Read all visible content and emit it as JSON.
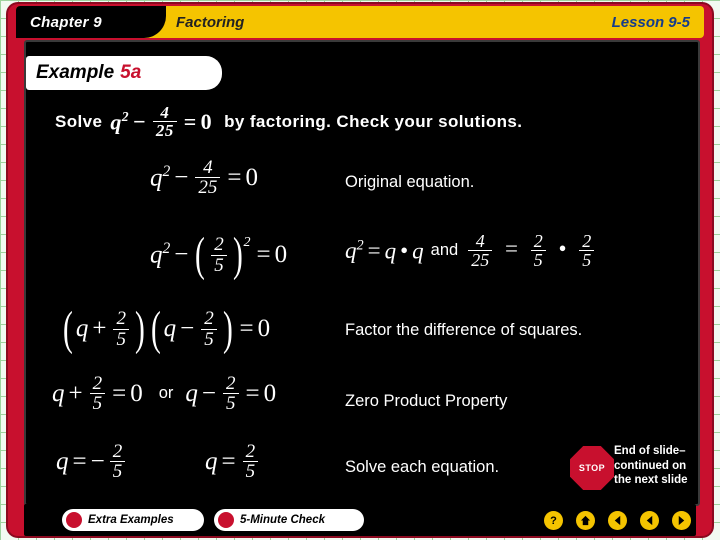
{
  "banner": {
    "chapter": "Chapter 9",
    "topic": "Factoring",
    "lesson": "Lesson 9-5"
  },
  "example_tab": {
    "label": "Example",
    "number": "5a"
  },
  "problem": {
    "solve_word": "Solve",
    "equation": "q² − 4/25 = 0",
    "instruction": "by factoring. Check your solutions."
  },
  "steps": [
    {
      "math": "q² − 4/25 = 0",
      "reason": "Original equation."
    },
    {
      "math": "q² − (2/5)² = 0",
      "reason_math_left": "q² = q • q",
      "reason_and": "and",
      "reason_math_right": "4/25 = 2/5 • 2/5"
    },
    {
      "math": "(q + 2/5)(q − 2/5) = 0",
      "reason": "Factor the difference of squares."
    },
    {
      "math": "q + 2/5 = 0  or  q − 2/5 = 0",
      "reason": "Zero Product Property",
      "or_word": "or"
    },
    {
      "math": "q = −2/5    q = 2/5",
      "reason": "Solve each equation."
    }
  ],
  "end_marker": {
    "stop_label": "STOP",
    "line1": "End of slide–",
    "line2": "continued on",
    "line3": "the next slide"
  },
  "footer": {
    "extra_examples": "Extra Examples",
    "five_minute_check": "5-Minute Check",
    "help_icon": "question-mark-icon",
    "home_icon": "home-icon",
    "back_icon": "previous-arrow-icon",
    "prev_icon": "rewind-arrow-icon",
    "next_icon": "next-arrow-icon"
  },
  "colors": {
    "banner": "#f5c400",
    "frame": "#c8102e",
    "panel": "#000000",
    "lesson_text": "#143c8c"
  }
}
